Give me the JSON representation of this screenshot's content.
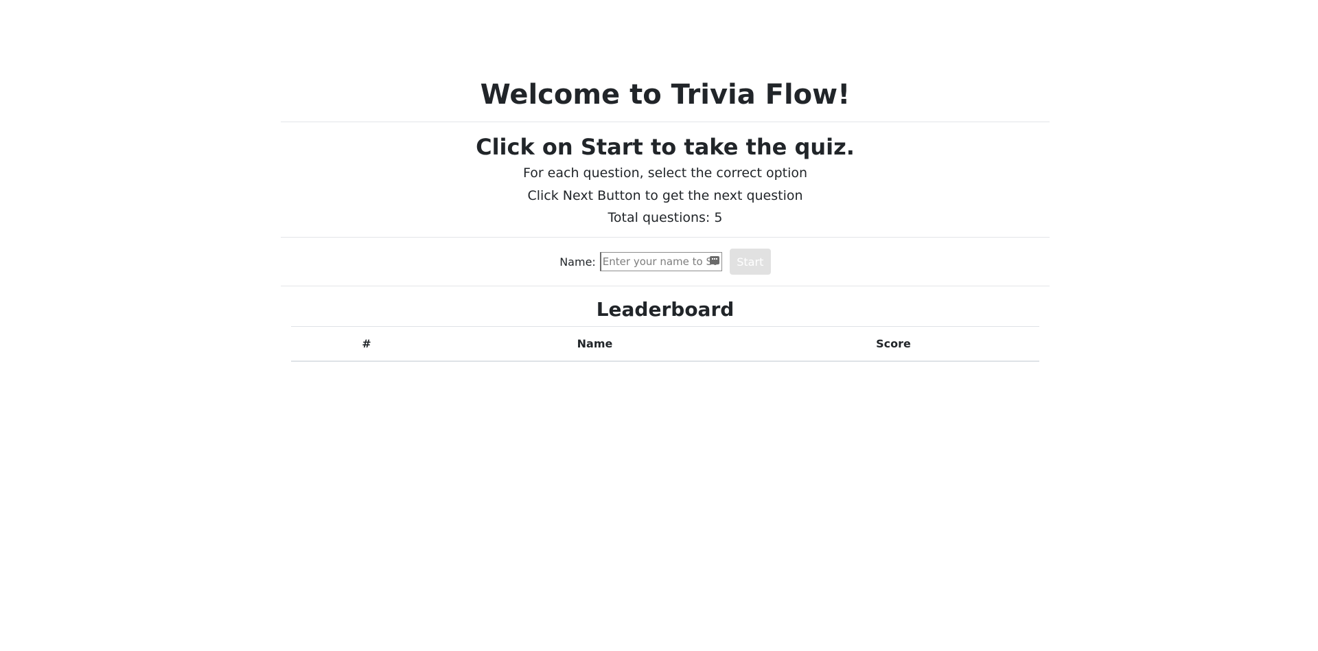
{
  "header": {
    "title": "Welcome to Trivia Flow!"
  },
  "instructions": {
    "heading": "Click on Start to take the quiz.",
    "line1": "For each question, select the correct option",
    "line2": "Click Next Button to get the next question",
    "line3": "Total questions: 5"
  },
  "form": {
    "name_label": "Name:",
    "name_placeholder": "Enter your name to Start",
    "name_value": "",
    "start_label": "Start"
  },
  "leaderboard": {
    "title": "Leaderboard",
    "columns": [
      "#",
      "Name",
      "Score"
    ],
    "rows": []
  },
  "colors": {
    "text": "#212529",
    "divider": "#e3e5e8",
    "start_button_disabled": "#e1e1e1"
  },
  "icons": {
    "input_icon": "password-manager-key-icon"
  }
}
